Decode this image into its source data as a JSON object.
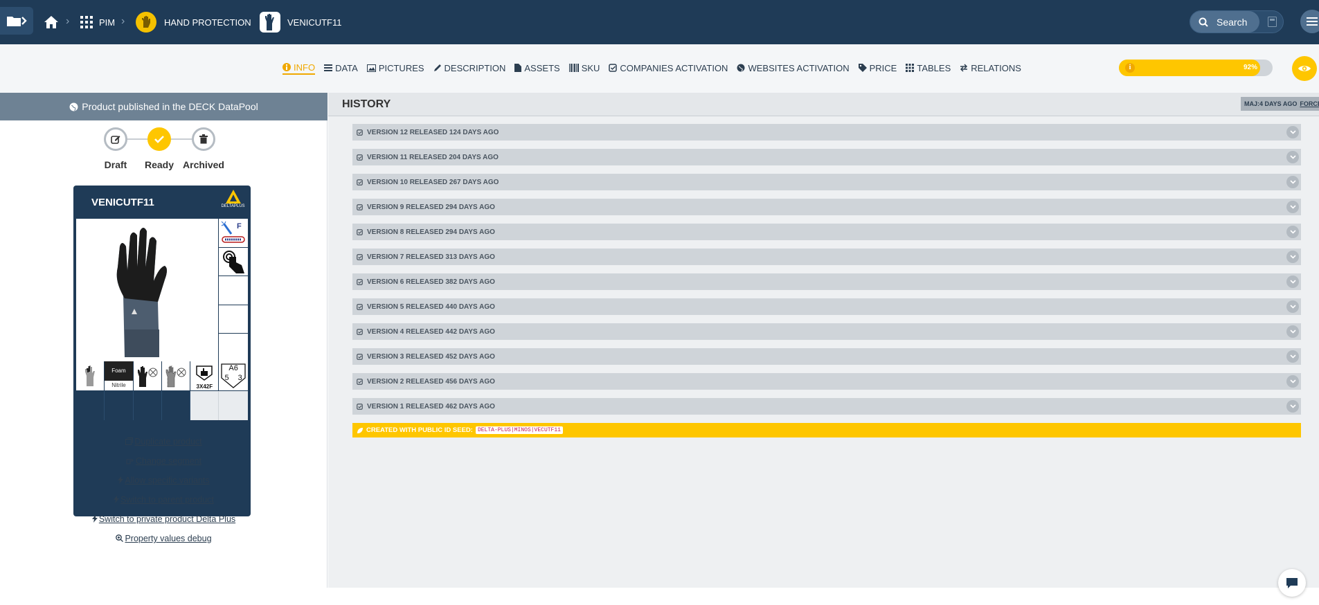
{
  "breadcrumb": {
    "pim": "PIM",
    "category": "HAND PROTECTION",
    "product": "VENICUTF11"
  },
  "search": {
    "label": "Search"
  },
  "tabs": [
    {
      "label": "INFO",
      "icon": "info-icon",
      "active": true
    },
    {
      "label": "DATA",
      "icon": "list-icon"
    },
    {
      "label": "PICTURES",
      "icon": "image-icon"
    },
    {
      "label": "DESCRIPTION",
      "icon": "pencil-icon"
    },
    {
      "label": "ASSETS",
      "icon": "file-icon"
    },
    {
      "label": "SKU",
      "icon": "barcode-icon"
    },
    {
      "label": "COMPANIES ACTIVATION",
      "icon": "checkbox-icon"
    },
    {
      "label": "WEBSITES ACTIVATION",
      "icon": "globe-icon"
    },
    {
      "label": "PRICE",
      "icon": "tag-icon"
    },
    {
      "label": "TABLES",
      "icon": "grid-icon"
    },
    {
      "label": "RELATIONS",
      "icon": "exchange-icon"
    }
  ],
  "completion": {
    "value": 0.92,
    "text": "92%",
    "accent": "#fec600"
  },
  "publish": {
    "text": "Product published in the DECK DataPool"
  },
  "workflow": [
    {
      "label": "Draft",
      "icon": "edit-icon",
      "state": "inactive"
    },
    {
      "label": "Ready",
      "icon": "check-icon",
      "state": "current"
    },
    {
      "label": "Archived",
      "icon": "trash-icon",
      "state": "inactive"
    }
  ],
  "card": {
    "title": "VENICUTF11",
    "brand": "DELTAPLUS",
    "side_badge": "F",
    "picto_foam": "Foam",
    "picto_nitrile": "Nitrile",
    "picto_en388": "3X42F",
    "picto_a6": "A6",
    "picto_a6_left": "5",
    "picto_a6_right": "3"
  },
  "actions": [
    {
      "label": "Duplicate product",
      "icon": "duplicate-icon"
    },
    {
      "label": "Change segment",
      "icon": "hand-point-icon"
    },
    {
      "label": "Allow specific variants",
      "icon": "bolt-icon"
    },
    {
      "label": "Switch to parent product",
      "icon": "bolt-icon"
    },
    {
      "label": "Switch to private product Delta Plus",
      "icon": "bolt-icon"
    },
    {
      "label": "Property values debug",
      "icon": "search-plus-icon"
    }
  ],
  "history": {
    "title": "HISTORY",
    "mai": "MAJ:4 DAYS AGO",
    "force": "FORCE",
    "versions": [
      "VERSION 12 RELEASED 124 DAYS AGO",
      "VERSION 11 RELEASED 204 DAYS AGO",
      "VERSION 10 RELEASED 267 DAYS AGO",
      "VERSION 9 RELEASED 294 DAYS AGO",
      "VERSION 8 RELEASED 294 DAYS AGO",
      "VERSION 7 RELEASED 313 DAYS AGO",
      "VERSION 6 RELEASED 382 DAYS AGO",
      "VERSION 5 RELEASED 440 DAYS AGO",
      "VERSION 4 RELEASED 442 DAYS AGO",
      "VERSION 3 RELEASED 452 DAYS AGO",
      "VERSION 2 RELEASED 456 DAYS AGO",
      "VERSION 1 RELEASED 462 DAYS AGO"
    ],
    "created_label": "CREATED WITH PUBLIC ID SEED:",
    "seed": "DELTA-PLUS|MINOS|VECUTF11"
  }
}
